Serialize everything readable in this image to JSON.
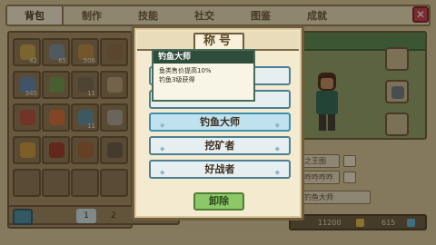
{
  "tabs": [
    {
      "label": "背包",
      "active": true
    },
    {
      "label": "制作"
    },
    {
      "label": "技能"
    },
    {
      "label": "社交"
    },
    {
      "label": "图鉴"
    },
    {
      "label": "成就"
    }
  ],
  "close_icon": "close-icon",
  "inventory": {
    "counts": [
      "42",
      "65",
      "506",
      "",
      "",
      "345",
      "",
      "11",
      "",
      "",
      "",
      "",
      "11",
      "",
      "",
      "",
      "",
      "",
      "",
      "",
      "",
      "",
      "",
      "",
      ""
    ],
    "pages": [
      "1",
      "2"
    ]
  },
  "character": {
    "info_rows": [
      "之王图",
      "咋咋咋咋",
      "钓鱼大师"
    ]
  },
  "money": {
    "gold": "11200",
    "gems": "615"
  },
  "dialog": {
    "title": "称号",
    "titles": [
      {
        "label": "",
        "selected": false
      },
      {
        "label": "",
        "selected": false
      },
      {
        "label": "钓鱼大师",
        "selected": true
      },
      {
        "label": "挖矿者",
        "selected": false
      },
      {
        "label": "好战者",
        "selected": false
      }
    ],
    "remove_label": "卸除"
  },
  "tooltip": {
    "name": "钓鱼大师",
    "effect": "鱼类售价提高10%",
    "source": "钓鱼3级获得"
  }
}
